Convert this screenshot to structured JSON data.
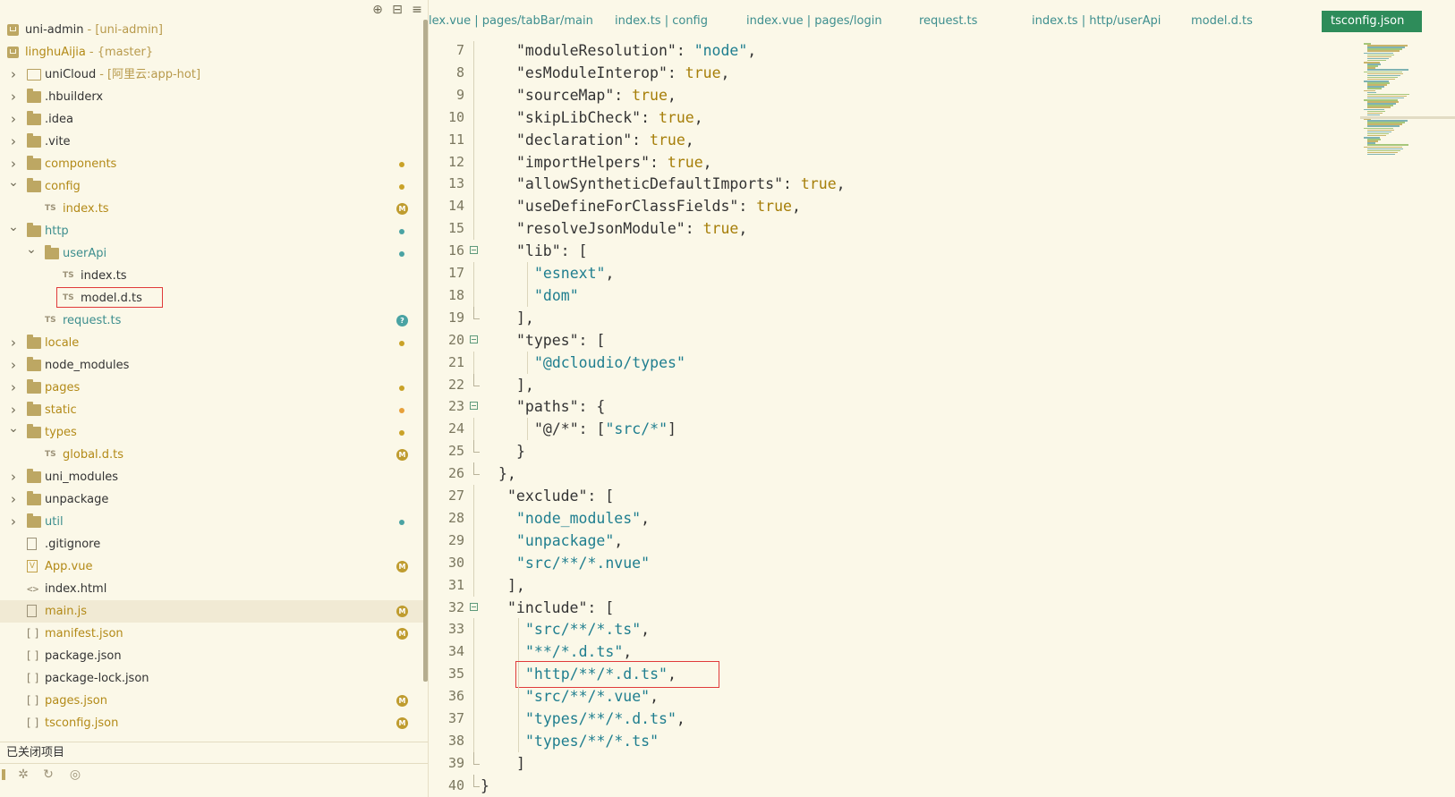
{
  "sidebar": {
    "toolbar": {
      "icons": [
        "crosshair-icon",
        "collapse-icon",
        "menu-icon"
      ]
    },
    "tree": [
      {
        "label": "uni-admin",
        "suffix": "- [uni-admin]",
        "kind": "project",
        "depth": 0,
        "expand": "none",
        "color": "dark"
      },
      {
        "label": "linghuAijia",
        "suffix": "- {master}",
        "kind": "project",
        "depth": 0,
        "expand": "none",
        "color": "mod"
      },
      {
        "label": "uniCloud",
        "suffix": "- [阿里云:app-hot]",
        "kind": "folder-open",
        "depth": 0,
        "expand": "closed",
        "color": "dark"
      },
      {
        "label": ".hbuilderx",
        "kind": "folder",
        "depth": 0,
        "expand": "closed",
        "color": "dark"
      },
      {
        "label": ".idea",
        "kind": "folder",
        "depth": 0,
        "expand": "closed",
        "color": "dark"
      },
      {
        "label": ".vite",
        "kind": "folder",
        "depth": 0,
        "expand": "closed",
        "color": "dark"
      },
      {
        "label": "components",
        "kind": "folder",
        "depth": 0,
        "expand": "closed",
        "color": "mod",
        "marker": "dot-gold"
      },
      {
        "label": "config",
        "kind": "folder",
        "depth": 0,
        "expand": "open",
        "color": "mod",
        "marker": "dot-gold"
      },
      {
        "label": "index.ts",
        "kind": "ts",
        "depth": 1,
        "expand": "none",
        "color": "mod",
        "marker": "badge-M"
      },
      {
        "label": "http",
        "kind": "folder",
        "depth": 0,
        "expand": "open",
        "color": "new",
        "marker": "dot-teal"
      },
      {
        "label": "userApi",
        "kind": "folder",
        "depth": 1,
        "expand": "open",
        "color": "new",
        "marker": "dot-teal"
      },
      {
        "label": "index.ts",
        "kind": "ts",
        "depth": 2,
        "expand": "none",
        "color": "dark"
      },
      {
        "label": "model.d.ts",
        "kind": "ts",
        "depth": 2,
        "expand": "none",
        "color": "dark",
        "highlight": true
      },
      {
        "label": "request.ts",
        "kind": "ts",
        "depth": 1,
        "expand": "none",
        "color": "new",
        "marker": "badge-?"
      },
      {
        "label": "locale",
        "kind": "folder",
        "depth": 0,
        "expand": "closed",
        "color": "mod",
        "marker": "dot-gold"
      },
      {
        "label": "node_modules",
        "kind": "folder",
        "depth": 0,
        "expand": "closed",
        "color": "dark"
      },
      {
        "label": "pages",
        "kind": "folder",
        "depth": 0,
        "expand": "closed",
        "color": "mod",
        "marker": "dot-gold"
      },
      {
        "label": "static",
        "kind": "folder",
        "depth": 0,
        "expand": "closed",
        "color": "mod",
        "marker": "dot-orange"
      },
      {
        "label": "types",
        "kind": "folder",
        "depth": 0,
        "expand": "open",
        "color": "mod",
        "marker": "dot-gold"
      },
      {
        "label": "global.d.ts",
        "kind": "ts",
        "depth": 1,
        "expand": "none",
        "color": "mod",
        "marker": "badge-M"
      },
      {
        "label": "uni_modules",
        "kind": "folder",
        "depth": 0,
        "expand": "closed",
        "color": "dark"
      },
      {
        "label": "unpackage",
        "kind": "folder",
        "depth": 0,
        "expand": "closed",
        "color": "dark"
      },
      {
        "label": "util",
        "kind": "folder",
        "depth": 0,
        "expand": "closed",
        "color": "new",
        "marker": "dot-teal"
      },
      {
        "label": ".gitignore",
        "kind": "file",
        "depth": 0,
        "expand": "none",
        "color": "dark"
      },
      {
        "label": "App.vue",
        "kind": "vue",
        "depth": 0,
        "expand": "none",
        "color": "mod",
        "marker": "badge-M"
      },
      {
        "label": "index.html",
        "kind": "tag",
        "depth": 0,
        "expand": "none",
        "color": "dark"
      },
      {
        "label": "main.js",
        "kind": "file",
        "depth": 0,
        "expand": "none",
        "color": "mod",
        "marker": "badge-M",
        "selected": true
      },
      {
        "label": "manifest.json",
        "kind": "bracket",
        "depth": 0,
        "expand": "none",
        "color": "mod",
        "marker": "badge-M"
      },
      {
        "label": "package.json",
        "kind": "bracket",
        "depth": 0,
        "expand": "none",
        "color": "dark"
      },
      {
        "label": "package-lock.json",
        "kind": "bracket",
        "depth": 0,
        "expand": "none",
        "color": "dark"
      },
      {
        "label": "pages.json",
        "kind": "bracket",
        "depth": 0,
        "expand": "none",
        "color": "mod",
        "marker": "badge-M"
      },
      {
        "label": "tsconfig.json",
        "kind": "bracket",
        "depth": 0,
        "expand": "none",
        "color": "mod",
        "marker": "badge-M"
      }
    ],
    "closed_projects_label": "已关闭项目",
    "status_icons": [
      "bug-icon",
      "refresh-icon",
      "globe-icon"
    ]
  },
  "tabs": [
    {
      "label": "lex.vue | pages/tabBar/main",
      "active": false
    },
    {
      "label": "index.ts | config",
      "active": false
    },
    {
      "label": "index.vue | pages/login",
      "active": false
    },
    {
      "label": "request.ts",
      "active": false
    },
    {
      "label": "index.ts | http/userApi",
      "active": false
    },
    {
      "label": "model.d.ts",
      "active": false
    },
    {
      "label": "tsconfig.json",
      "active": true
    }
  ],
  "code": {
    "lines": [
      {
        "n": "7",
        "indent": 2,
        "tokens": [
          [
            "k",
            "\"moduleResolution\""
          ],
          [
            "p",
            ": "
          ],
          [
            "s",
            "\"node\""
          ],
          [
            "p",
            ","
          ]
        ]
      },
      {
        "n": "8",
        "indent": 2,
        "tokens": [
          [
            "k",
            "\"esModuleInterop\""
          ],
          [
            "p",
            ": "
          ],
          [
            "b",
            "true"
          ],
          [
            "p",
            ","
          ]
        ]
      },
      {
        "n": "9",
        "indent": 2,
        "tokens": [
          [
            "k",
            "\"sourceMap\""
          ],
          [
            "p",
            ": "
          ],
          [
            "b",
            "true"
          ],
          [
            "p",
            ","
          ]
        ]
      },
      {
        "n": "10",
        "indent": 2,
        "tokens": [
          [
            "k",
            "\"skipLibCheck\""
          ],
          [
            "p",
            ": "
          ],
          [
            "b",
            "true"
          ],
          [
            "p",
            ","
          ]
        ]
      },
      {
        "n": "11",
        "indent": 2,
        "tokens": [
          [
            "k",
            "\"declaration\""
          ],
          [
            "p",
            ": "
          ],
          [
            "b",
            "true"
          ],
          [
            "p",
            ","
          ]
        ]
      },
      {
        "n": "12",
        "indent": 2,
        "tokens": [
          [
            "k",
            "\"importHelpers\""
          ],
          [
            "p",
            ": "
          ],
          [
            "b",
            "true"
          ],
          [
            "p",
            ","
          ]
        ]
      },
      {
        "n": "13",
        "indent": 2,
        "tokens": [
          [
            "k",
            "\"allowSyntheticDefaultImports\""
          ],
          [
            "p",
            ": "
          ],
          [
            "b",
            "true"
          ],
          [
            "p",
            ","
          ]
        ]
      },
      {
        "n": "14",
        "indent": 2,
        "tokens": [
          [
            "k",
            "\"useDefineForClassFields\""
          ],
          [
            "p",
            ": "
          ],
          [
            "b",
            "true"
          ],
          [
            "p",
            ","
          ]
        ]
      },
      {
        "n": "15",
        "indent": 2,
        "tokens": [
          [
            "k",
            "\"resolveJsonModule\""
          ],
          [
            "p",
            ": "
          ],
          [
            "b",
            "true"
          ],
          [
            "p",
            ","
          ]
        ]
      },
      {
        "n": "16",
        "indent": 2,
        "fold": "start",
        "tokens": [
          [
            "k",
            "\"lib\""
          ],
          [
            "p",
            ": ["
          ]
        ]
      },
      {
        "n": "17",
        "indent": 3,
        "tokens": [
          [
            "s",
            "\"esnext\""
          ],
          [
            "p",
            ","
          ]
        ]
      },
      {
        "n": "18",
        "indent": 3,
        "tokens": [
          [
            "s",
            "\"dom\""
          ]
        ]
      },
      {
        "n": "19",
        "indent": 2,
        "fold": "end",
        "tokens": [
          [
            "p",
            "],"
          ]
        ]
      },
      {
        "n": "20",
        "indent": 2,
        "fold": "start",
        "tokens": [
          [
            "k",
            "\"types\""
          ],
          [
            "p",
            ": ["
          ]
        ]
      },
      {
        "n": "21",
        "indent": 3,
        "tokens": [
          [
            "s",
            "\"@dcloudio/types\""
          ]
        ]
      },
      {
        "n": "22",
        "indent": 2,
        "fold": "end",
        "tokens": [
          [
            "p",
            "],"
          ]
        ]
      },
      {
        "n": "23",
        "indent": 2,
        "fold": "start",
        "tokens": [
          [
            "k",
            "\"paths\""
          ],
          [
            "p",
            ": {"
          ]
        ]
      },
      {
        "n": "24",
        "indent": 3,
        "tokens": [
          [
            "k",
            "\"@/*\""
          ],
          [
            "p",
            ": ["
          ],
          [
            "s",
            "\"src/*\""
          ],
          [
            "p",
            "]"
          ]
        ]
      },
      {
        "n": "25",
        "indent": 2,
        "fold": "end",
        "tokens": [
          [
            "p",
            "}"
          ]
        ]
      },
      {
        "n": "26",
        "indent": 1,
        "fold": "end",
        "tokens": [
          [
            "p",
            "},"
          ]
        ]
      },
      {
        "n": "27",
        "indent": 1.5,
        "tokens": [
          [
            "k",
            "\"exclude\""
          ],
          [
            "p",
            ": ["
          ]
        ]
      },
      {
        "n": "28",
        "indent": 2,
        "tokens": [
          [
            "s",
            "\"node_modules\""
          ],
          [
            "p",
            ","
          ]
        ]
      },
      {
        "n": "29",
        "indent": 2,
        "tokens": [
          [
            "s",
            "\"unpackage\""
          ],
          [
            "p",
            ","
          ]
        ]
      },
      {
        "n": "30",
        "indent": 2,
        "tokens": [
          [
            "s",
            "\"src/**/*.nvue\""
          ]
        ]
      },
      {
        "n": "31",
        "indent": 1.5,
        "tokens": [
          [
            "p",
            "],"
          ]
        ]
      },
      {
        "n": "32",
        "indent": 1.5,
        "fold": "start",
        "tokens": [
          [
            "k",
            "\"include\""
          ],
          [
            "p",
            ": ["
          ]
        ]
      },
      {
        "n": "33",
        "indent": 2.5,
        "tokens": [
          [
            "s",
            "\"src/**/*.ts\""
          ],
          [
            "p",
            ","
          ]
        ]
      },
      {
        "n": "34",
        "indent": 2.5,
        "tokens": [
          [
            "s",
            "\"**/*.d.ts\""
          ],
          [
            "p",
            ","
          ]
        ]
      },
      {
        "n": "35",
        "indent": 2.5,
        "highlight": true,
        "tokens": [
          [
            "s",
            "\"http/**/*.d.ts\""
          ],
          [
            "p",
            ","
          ]
        ]
      },
      {
        "n": "36",
        "indent": 2.5,
        "tokens": [
          [
            "s",
            "\"src/**/*.vue\""
          ],
          [
            "p",
            ","
          ]
        ]
      },
      {
        "n": "37",
        "indent": 2.5,
        "tokens": [
          [
            "s",
            "\"types/**/*.d.ts\""
          ],
          [
            "p",
            ","
          ]
        ]
      },
      {
        "n": "38",
        "indent": 2.5,
        "tokens": [
          [
            "s",
            "\"types/**/*.ts\""
          ]
        ]
      },
      {
        "n": "39",
        "indent": 2,
        "fold": "end",
        "tokens": [
          [
            "p",
            "]"
          ]
        ]
      },
      {
        "n": "40",
        "indent": 0,
        "fold": "end",
        "tokens": [
          [
            "p",
            "}"
          ]
        ]
      }
    ]
  },
  "colors": {
    "background": "#fbf8e8",
    "modified": "#b38a18",
    "new": "#3d8e8e",
    "string": "#1f7e8f",
    "boolean": "#a67e08",
    "active_tab": "#2e8c5a",
    "highlight_box": "#e03a3a"
  }
}
